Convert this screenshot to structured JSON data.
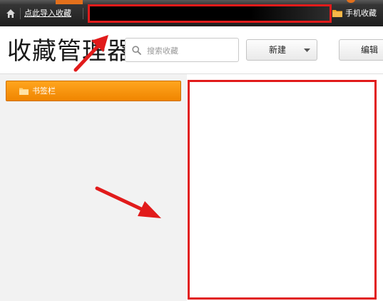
{
  "topbar": {
    "import_label": "点此导入收藏",
    "mobile_label": "手机收藏",
    "home_icon": "home-icon",
    "folder_icon": "folder-icon"
  },
  "header": {
    "title": "收藏管理器",
    "search": {
      "placeholder": "搜索收藏",
      "value": ""
    },
    "new_button": "新建",
    "edit_button": "编辑"
  },
  "sidebar": {
    "items": [
      {
        "label": "书签栏",
        "icon": "folder-icon",
        "selected": true
      }
    ]
  },
  "colors": {
    "accent_orange": "#f08500",
    "highlight_red": "#e11b1b",
    "topbar_dark": "#1e1e1e"
  }
}
